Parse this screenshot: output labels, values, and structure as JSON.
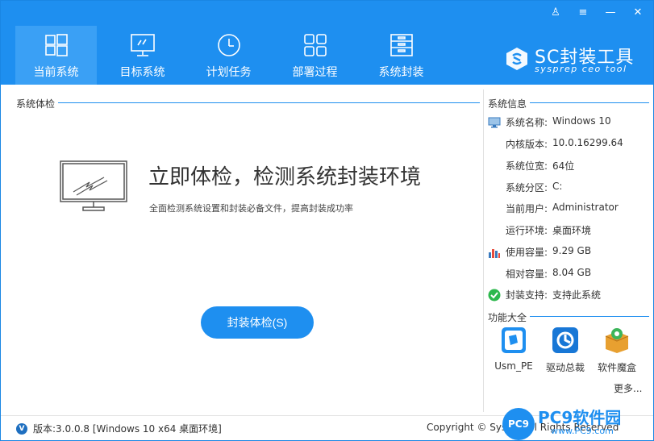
{
  "window_controls": {
    "user": "♙",
    "menu": "≡",
    "minimize": "—",
    "close": "✕"
  },
  "tabs": [
    {
      "label": "当前系统",
      "icon": "windows-logo-icon",
      "active": true
    },
    {
      "label": "目标系统",
      "icon": "monitor-icon",
      "active": false
    },
    {
      "label": "计划任务",
      "icon": "clock-icon",
      "active": false
    },
    {
      "label": "部署过程",
      "icon": "grid-squares-icon",
      "active": false
    },
    {
      "label": "系统封装",
      "icon": "archive-box-icon",
      "active": false
    }
  ],
  "logo": {
    "name": "SC封装工具",
    "sub": "sysprep ceo tool"
  },
  "check": {
    "section_title": "系统体检",
    "headline": "立即体检，检测系统封装环境",
    "subline": "全面检测系统设置和封装必备文件，提高封装成功率",
    "button": "封装体检(S)"
  },
  "info": {
    "section_title": "系统信息",
    "rows": [
      {
        "key": "系统名称:",
        "value": "Windows 10",
        "icon": "monitor-icon"
      },
      {
        "key": "内核版本:",
        "value": "10.0.16299.64",
        "icon": ""
      },
      {
        "key": "系统位宽:",
        "value": "64位",
        "icon": ""
      },
      {
        "key": "系统分区:",
        "value": "C:",
        "icon": ""
      },
      {
        "key": "当前用户:",
        "value": "Administrator",
        "icon": ""
      },
      {
        "key": "运行环境:",
        "value": "桌面环境",
        "icon": ""
      },
      {
        "key": "使用容量:",
        "value": "9.29 GB",
        "icon": "bar-chart-icon"
      },
      {
        "key": "相对容量:",
        "value": "8.04 GB",
        "icon": ""
      },
      {
        "key": "封装支持:",
        "value": "支持此系统",
        "icon": "check-circle-icon"
      }
    ]
  },
  "tools": {
    "section_title": "功能大全",
    "items": [
      {
        "label": "Usm_PE",
        "icon": "usm-pe-icon",
        "color": "#1e8ff0"
      },
      {
        "label": "驱动总裁",
        "icon": "driver-tool-icon",
        "color": "#1877d6"
      },
      {
        "label": "软件魔盒",
        "icon": "software-box-icon",
        "color": "#e8a030"
      }
    ],
    "more": "更多..."
  },
  "footer": {
    "version": "版本:3.0.0.8 [Windows 10 x64 桌面环境]",
    "copyright": "Copyright © Sys...n All Rights Reserved"
  },
  "watermark": {
    "badge": "PC9",
    "title": "PC9软件园",
    "sub": "www.PC9.com"
  },
  "colors": {
    "accent": "#1e8ff0",
    "active_tab": "#3aa0f5"
  }
}
